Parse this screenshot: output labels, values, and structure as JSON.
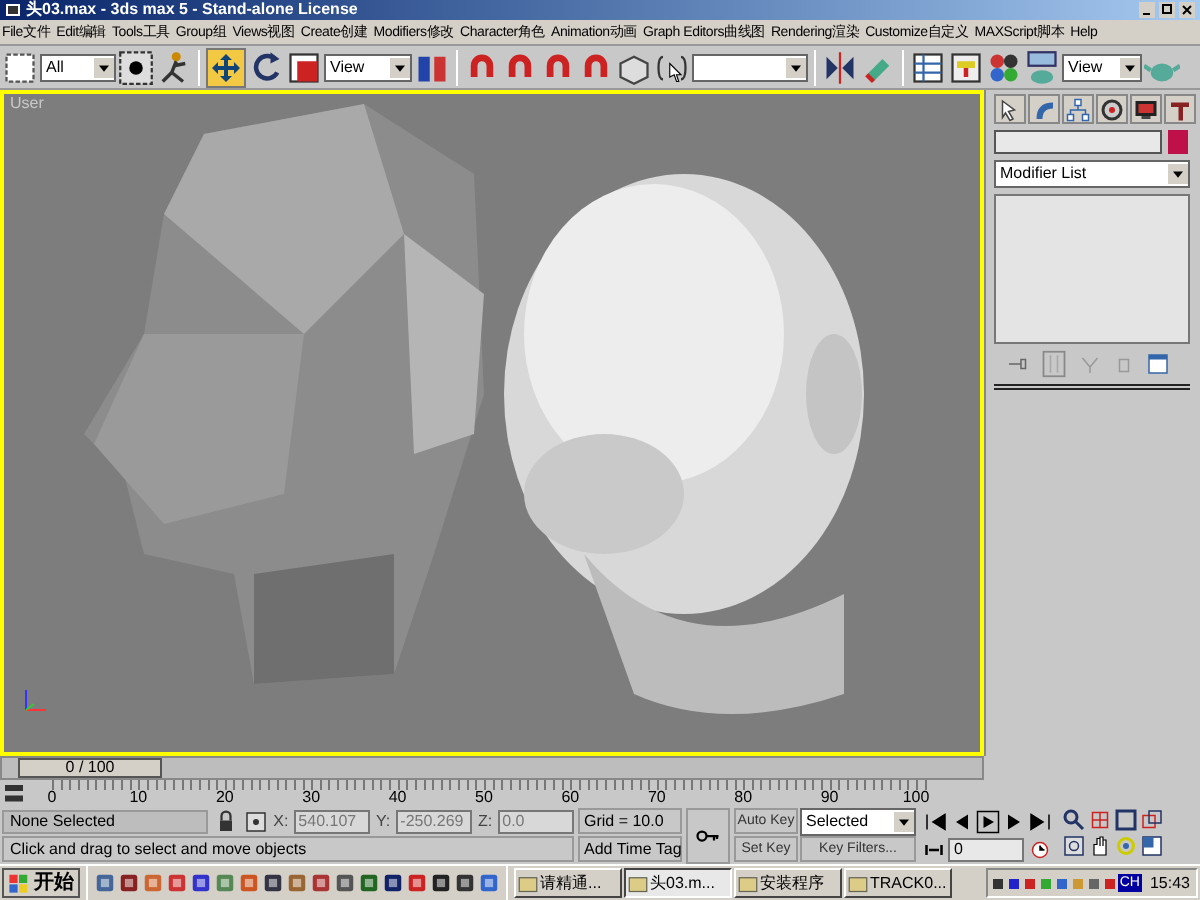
{
  "window": {
    "title": "头03.max - 3ds max 5 - Stand-alone License"
  },
  "menu": [
    "File文件",
    "Edit编辑",
    "Tools工具",
    "Group组",
    "Views视图",
    "Create创建",
    "Modifiers修改",
    "Character角色",
    "Animation动画",
    "Graph Editors曲线图",
    "Rendering渲染",
    "Customize自定义",
    "MAXScript脚本",
    "Help"
  ],
  "toolbar": {
    "selection_filter": "All",
    "coordinate_system": "View",
    "render_type": "View"
  },
  "viewport": {
    "label": "User"
  },
  "command_panel": {
    "modifier_list": "Modifier List"
  },
  "time_slider": {
    "label": "0 / 100",
    "level": 0
  },
  "ruler": {
    "ticks": [
      "0",
      "10",
      "20",
      "30",
      "40",
      "50",
      "60",
      "70",
      "80",
      "90",
      "100"
    ]
  },
  "status": {
    "selection": "None Selected",
    "prompt": "Click and drag to select and move objects",
    "coordinates": [
      {
        "label": "X:",
        "value": "540.107"
      },
      {
        "label": "Y:",
        "value": "-250.269"
      },
      {
        "label": "Z:",
        "value": "0.0"
      }
    ],
    "grid": "Grid = 10.0",
    "time_tag": "Add Time Tag"
  },
  "animation": {
    "auto_key": "Auto Key",
    "key_mode": "Selected",
    "set_key": "Set Key",
    "key_filters": "Key Filters...",
    "frame": "0"
  },
  "taskbar": {
    "start": "开始",
    "tasks": [
      {
        "label": "请精通...",
        "selected": false
      },
      {
        "label": "头03.m...",
        "selected": true
      },
      {
        "label": "安装程序",
        "selected": false
      },
      {
        "label": "TRACK0...",
        "selected": false
      }
    ],
    "language": "CH",
    "clock": "15:43"
  }
}
